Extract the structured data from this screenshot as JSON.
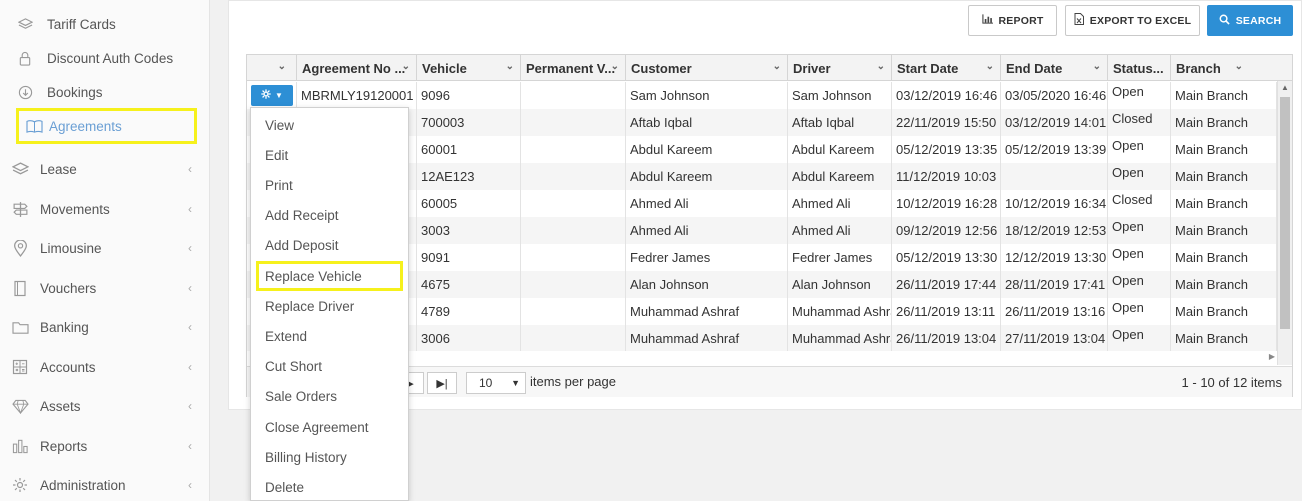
{
  "sidebar": {
    "sub_items": [
      {
        "label": "Tariff Cards",
        "icon": "layers-icon"
      },
      {
        "label": "Discount Auth Codes",
        "icon": "lock-icon"
      },
      {
        "label": "Bookings",
        "icon": "download-circle-icon"
      },
      {
        "label": "Agreements",
        "icon": "book-icon",
        "active": true
      }
    ],
    "items": [
      {
        "label": "Lease",
        "icon": "layers-icon"
      },
      {
        "label": "Movements",
        "icon": "signpost-icon"
      },
      {
        "label": "Limousine",
        "icon": "map-pin-icon"
      },
      {
        "label": "Vouchers",
        "icon": "document-icon"
      },
      {
        "label": "Banking",
        "icon": "folder-icon"
      },
      {
        "label": "Accounts",
        "icon": "calculator-icon"
      },
      {
        "label": "Assets",
        "icon": "diamond-icon"
      },
      {
        "label": "Reports",
        "icon": "bar-chart-icon"
      },
      {
        "label": "Administration",
        "icon": "settings-icon"
      }
    ],
    "highlight_color": "#f6f11c",
    "active_color": "#6a9fd4"
  },
  "toolbar": {
    "report_label": "REPORT",
    "export_label": "EXPORT TO EXCEL",
    "search_label": "SEARCH",
    "primary_color": "#2d8fd5"
  },
  "grid": {
    "columns": [
      "",
      "Agreement No ...",
      "Vehicle",
      "Permanent V...",
      "Customer",
      "Driver",
      "Start Date",
      "End Date",
      "Status...",
      "Branch"
    ],
    "rows": [
      {
        "agreement_no": "MBRMLY19120001",
        "vehicle": "9096",
        "permanent": "",
        "customer": "Sam Johnson",
        "driver": "Sam Johnson",
        "start": "03/12/2019 16:46",
        "end": "03/05/2020 16:46",
        "status": "Open",
        "branch": "Main Branch"
      },
      {
        "agreement_no": "",
        "vehicle": "700003",
        "permanent": "",
        "customer": "Aftab Iqbal",
        "driver": "Aftab Iqbal",
        "start": "22/11/2019 15:50",
        "end": "03/12/2019 14:01",
        "status": "Closed",
        "branch": "Main Branch"
      },
      {
        "agreement_no": "",
        "vehicle": "60001",
        "permanent": "",
        "customer": "Abdul Kareem",
        "driver": "Abdul Kareem",
        "start": "05/12/2019 13:35",
        "end": "05/12/2019 13:39",
        "status": "Open",
        "branch": "Main Branch"
      },
      {
        "agreement_no": "",
        "vehicle": "12AE123",
        "permanent": "",
        "customer": "Abdul Kareem",
        "driver": "Abdul Kareem",
        "start": "11/12/2019 10:03",
        "end": "",
        "status": "Open",
        "branch": "Main Branch"
      },
      {
        "agreement_no": "",
        "vehicle": "60005",
        "permanent": "",
        "customer": "Ahmed Ali",
        "driver": "Ahmed Ali",
        "start": "10/12/2019 16:28",
        "end": "10/12/2019 16:34",
        "status": "Closed",
        "branch": "Main Branch"
      },
      {
        "agreement_no": "",
        "vehicle": "3003",
        "permanent": "",
        "customer": "Ahmed Ali",
        "driver": "Ahmed Ali",
        "start": "09/12/2019 12:56",
        "end": "18/12/2019 12:53",
        "status": "Open",
        "branch": "Main Branch"
      },
      {
        "agreement_no": "",
        "vehicle": "9091",
        "permanent": "",
        "customer": "Fedrer James",
        "driver": "Fedrer James",
        "start": "05/12/2019 13:30",
        "end": "12/12/2019 13:30",
        "status": "Open",
        "branch": "Main Branch"
      },
      {
        "agreement_no": "",
        "vehicle": "4675",
        "permanent": "",
        "customer": "Alan Johnson",
        "driver": "Alan Johnson",
        "start": "26/11/2019 17:44",
        "end": "28/11/2019 17:41",
        "status": "Open",
        "branch": "Main Branch"
      },
      {
        "agreement_no": "",
        "vehicle": "4789",
        "permanent": "",
        "customer": "Muhammad Ashraf",
        "driver": "Muhammad Ashraf",
        "start": "26/11/2019 13:11",
        "end": "26/11/2019 13:16",
        "status": "Open",
        "branch": "Main Branch"
      },
      {
        "agreement_no": "",
        "vehicle": "3006",
        "permanent": "",
        "customer": "Muhammad Ashraf",
        "driver": "Muhammad Ashraf",
        "start": "26/11/2019 13:04",
        "end": "27/11/2019 13:04",
        "status": "Open",
        "branch": "Main Branch"
      }
    ]
  },
  "pager": {
    "last_label": "▶|",
    "page_size": "10",
    "items_per_page_label": "items per page",
    "info": "1 - 10 of 12 items"
  },
  "action_menu": {
    "items": [
      "View",
      "Edit",
      "Print",
      "Add Receipt",
      "Add Deposit",
      "Replace Vehicle",
      "Replace Driver",
      "Extend",
      "Cut Short",
      "Sale Orders",
      "Close Agreement",
      "Billing History",
      "Delete"
    ],
    "highlighted": "Replace Vehicle"
  }
}
